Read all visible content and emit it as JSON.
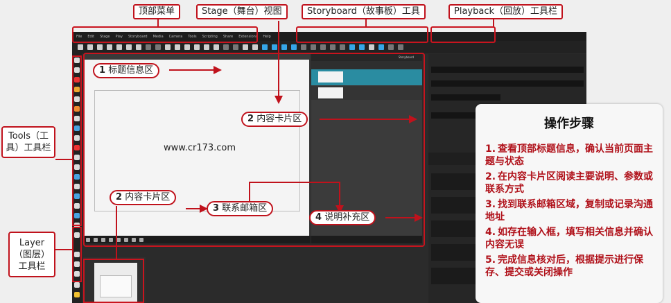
{
  "app": {
    "menu_items": [
      "File",
      "Edit",
      "Stage",
      "Play",
      "Storyboard",
      "Media",
      "Camera",
      "Tools",
      "Scripting",
      "Share",
      "Extensions",
      "Help"
    ],
    "storyboard_header": "Storyboard",
    "playback_label": "Playback",
    "url_text": "www.cr173.com"
  },
  "annotations": {
    "top_menu": "顶部菜单",
    "stage_view": "Stage（舞台）视图",
    "storyboard_toolbar": "Storyboard（故事板）工具",
    "playback_toolbar": "Playback（回放）工具栏",
    "tools_toolbar": "Tools（工具）工具栏",
    "layer_toolbar": "Layer（图层）工具栏",
    "callout_1": {
      "num": "1",
      "text": "标题信息区"
    },
    "callout_2a": {
      "num": "2",
      "text": "内容卡片区"
    },
    "callout_2b": {
      "num": "2",
      "text": "内容卡片区"
    },
    "callout_3": {
      "num": "3",
      "text": "联系邮箱区"
    },
    "callout_4": {
      "num": "4",
      "text": "说明补充区"
    }
  },
  "steps_panel": {
    "title": "操作步骤",
    "steps": [
      {
        "num": "1.",
        "text": "查看顶部标题信息，确认当前页面主题与状态"
      },
      {
        "num": "2.",
        "text": "在内容卡片区阅读主要说明、参数或联系方式"
      },
      {
        "num": "3.",
        "text": "找到联系邮箱区域，复制或记录沟通地址"
      },
      {
        "num": "4.",
        "text": "如存在输入框，填写相关信息并确认内容无误"
      },
      {
        "num": "5.",
        "text": "完成信息核对后，根据提示进行保存、提交或关闭操作"
      }
    ]
  },
  "colors": {
    "annotation_red": "#c0121c",
    "storyboard_selected": "#2a8ca1",
    "app_background": "#2b2b2b"
  }
}
